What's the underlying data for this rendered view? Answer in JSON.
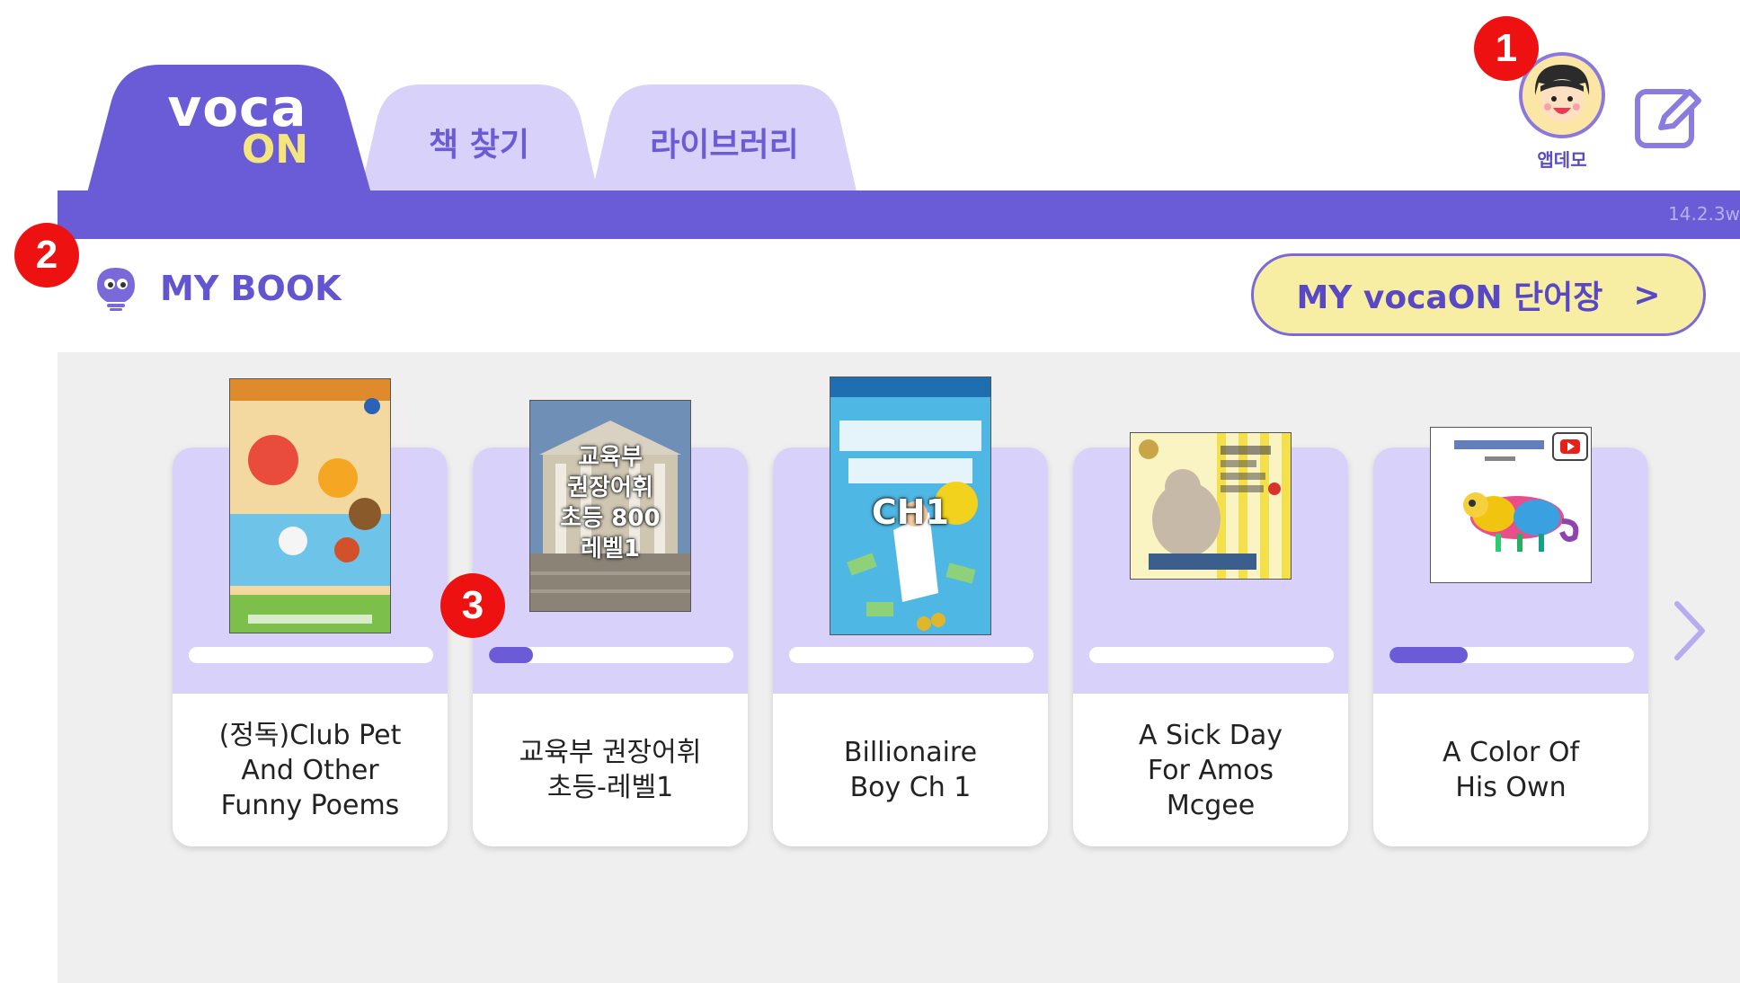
{
  "header": {
    "logo_top": "voca",
    "logo_bottom": "ON",
    "tabs": [
      {
        "label": "책 찾기"
      },
      {
        "label": "라이브러리"
      }
    ],
    "version": "14.2.3w",
    "profile_name": "앱데모"
  },
  "markers": [
    "1",
    "2",
    "3"
  ],
  "mybook": {
    "title": "MY BOOK",
    "vocab_button": "MY vocaON 단어장",
    "vocab_chevron": ">"
  },
  "books": [
    {
      "title_lines": [
        "(정독)Club Pet",
        "And Other",
        "Funny Poems"
      ],
      "progress": 0
    },
    {
      "title_lines": [
        "교육부 권장어휘",
        "초등-레벨1"
      ],
      "progress": 0.18,
      "cover_text": [
        "교육부",
        "권장어휘",
        "초등 800",
        "레벨1"
      ]
    },
    {
      "title_lines": [
        "Billionaire",
        "Boy Ch 1"
      ],
      "progress": 0,
      "cover_text": [
        "CH1"
      ]
    },
    {
      "title_lines": [
        "A Sick Day",
        "For Amos",
        "Mcgee"
      ],
      "progress": 0
    },
    {
      "title_lines": [
        "A Color Of",
        "His Own"
      ],
      "progress": 0.32
    }
  ],
  "colors": {
    "primary": "#6a5bd6",
    "tab_light": "#d8d2fa",
    "accent_yellow": "#f8eea3",
    "marker_red": "#ee1111"
  }
}
